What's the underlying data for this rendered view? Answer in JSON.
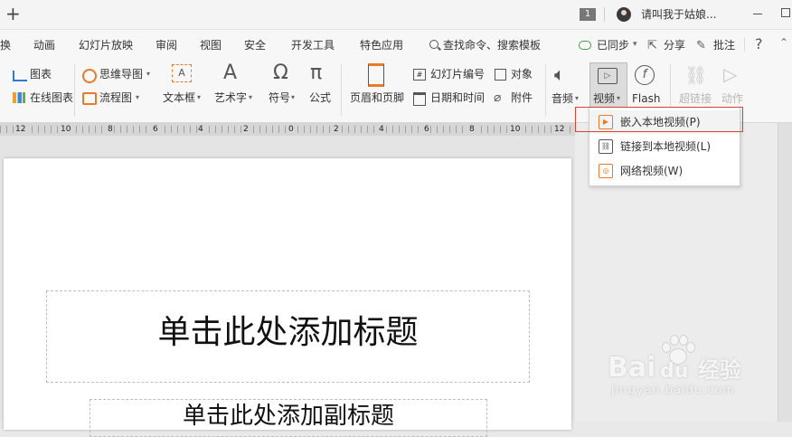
{
  "titlebar": {
    "add_tab": "+",
    "page_badge": "1",
    "user_name": "请叫我于姑娘..."
  },
  "menu": {
    "items": [
      "换",
      "动画",
      "幻灯片放映",
      "审阅",
      "视图",
      "安全",
      "开发工具",
      "特色应用"
    ],
    "search_label": "查找命令、搜索模板",
    "sync_label": "已同步",
    "share_label": "分享",
    "comment_label": "批注",
    "help": "?"
  },
  "ribbon": {
    "chart": "图表",
    "online_chart": "在线图表",
    "mindmap": "思维导图",
    "flowchart": "流程图",
    "textbox": "文本框",
    "wordart": "艺术字",
    "symbol": "符号",
    "formula": "公式",
    "header_footer": "页眉和页脚",
    "slide_number": "幻灯片编号",
    "datetime": "日期和时间",
    "object": "对象",
    "attachment": "附件",
    "audio": "音频",
    "video": "视频",
    "flash": "Flash",
    "hyperlink": "超链接",
    "action": "动作"
  },
  "ruler": {
    "labels": [
      "12",
      "10",
      "8",
      "6",
      "4",
      "2",
      "0",
      "2",
      "4",
      "6",
      "8",
      "10",
      "12"
    ]
  },
  "video_menu": {
    "items": [
      {
        "label": "嵌入本地视频(P)",
        "icon": "play-icon"
      },
      {
        "label": "链接到本地视频(L)",
        "icon": "video-link-icon"
      },
      {
        "label": "网络视频(W)",
        "icon": "web-video-icon"
      }
    ],
    "highlight_color": "#d9433a"
  },
  "slide": {
    "title_placeholder": "单击此处添加标题",
    "subtitle_placeholder": "单击此处添加副标题"
  },
  "watermark": {
    "brand": "Bai",
    "brand2": "经验",
    "url": "jingyan.baidu.com"
  }
}
